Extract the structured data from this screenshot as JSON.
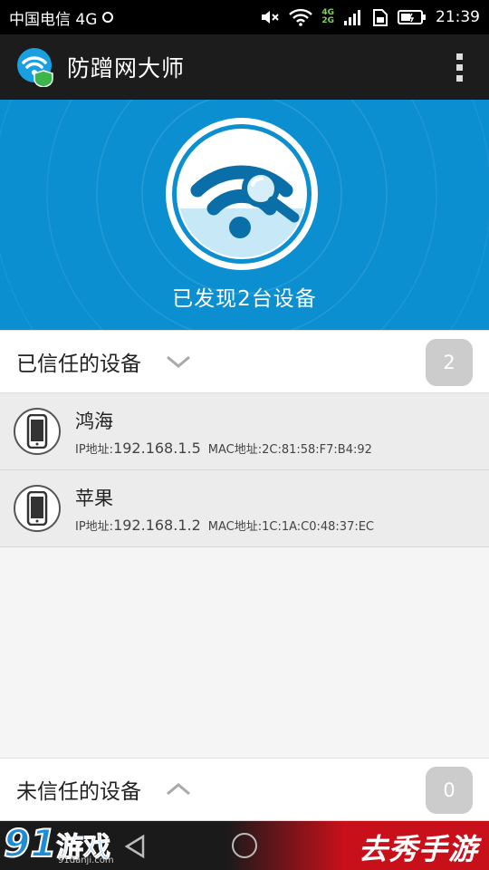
{
  "status_bar": {
    "carrier": "中国电信 4G",
    "network_badge_top": "4G",
    "network_badge_bottom": "2G",
    "time": "21:39",
    "icons": [
      "mute-icon",
      "wifi-icon",
      "signal-icon",
      "sim-icon",
      "battery-icon"
    ]
  },
  "app_bar": {
    "title": "防蹭网大师",
    "logo": "wifi-shield-logo",
    "menu": "overflow-menu-icon"
  },
  "hero": {
    "status_text": "已发现2台设备",
    "icon": "wifi-search-icon",
    "colors": {
      "background": "#0c8fd1"
    }
  },
  "trusted": {
    "title": "已信任的设备",
    "count": "2",
    "devices": [
      {
        "name": "鸿海",
        "ip_label": "IP地址:",
        "ip": "192.168.1.5",
        "mac": "MAC地址:2C:81:58:F7:B4:92"
      },
      {
        "name": "苹果",
        "ip_label": "IP地址:",
        "ip": "192.168.1.2",
        "mac": "MAC地址:1C:1A:C0:48:37:EC"
      }
    ]
  },
  "untrusted": {
    "title": "未信任的设备",
    "count": "0"
  },
  "nav_bar": {
    "watermark_num": "91",
    "watermark_text": "游戏",
    "watermark_sub": "91danji.com",
    "brand": "去秀手游"
  }
}
